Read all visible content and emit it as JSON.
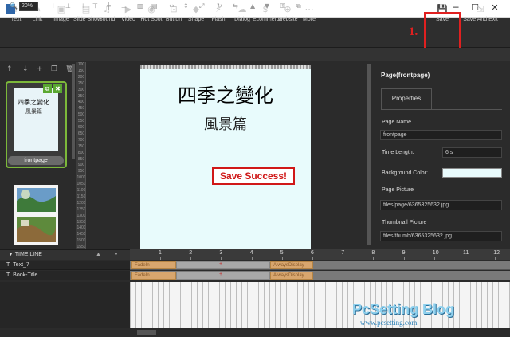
{
  "window": {
    "minimize": "─",
    "maximize": "☐",
    "close": "✕"
  },
  "toolbar": {
    "tools": [
      {
        "icon": "T",
        "label": "Text"
      },
      {
        "icon": "✎",
        "label": "Link"
      },
      {
        "icon": "▣",
        "label": "Image"
      },
      {
        "icon": "▤",
        "label": "Slide Show"
      },
      {
        "icon": "♫",
        "label": "Sound"
      },
      {
        "icon": "▶",
        "label": "Video"
      },
      {
        "icon": "◉",
        "label": "Hot Spot"
      },
      {
        "icon": "⊡",
        "label": "Button"
      },
      {
        "icon": "◆",
        "label": "Shape"
      },
      {
        "icon": "⚡",
        "label": "Flash"
      },
      {
        "icon": "☁",
        "label": "Dialog"
      },
      {
        "icon": "$",
        "label": "Ecommerce"
      },
      {
        "icon": "⊕",
        "label": "Website"
      },
      {
        "icon": "⋯",
        "label": "More"
      }
    ],
    "save": {
      "icon": "💾",
      "label": "Save"
    },
    "save_exit": {
      "icon": "⇲",
      "label": "Save And Exit"
    },
    "step_label": "1."
  },
  "subbar": {
    "zoom": "20%"
  },
  "pages": {
    "thumb1_label": "frontpage",
    "thumb1_title": "四季之變化",
    "thumb1_sub": "風景篇"
  },
  "ruler_numbers": [
    "100",
    "150",
    "200",
    "250",
    "300",
    "350",
    "400",
    "450",
    "500",
    "550",
    "600",
    "650",
    "700",
    "750",
    "800",
    "850",
    "900",
    "950",
    "1000",
    "1050",
    "1100",
    "1150",
    "1200",
    "1250",
    "1300",
    "1350",
    "1400",
    "1450",
    "1500",
    "1550"
  ],
  "canvas": {
    "title": "四季之變化",
    "subtitle": "風景篇",
    "toast": "Save Success!"
  },
  "properties": {
    "header": "Page(frontpage)",
    "tab": "Properties",
    "page_name_label": "Page Name",
    "page_name": "frontpage",
    "time_length_label": "Time Length:",
    "time_length": "6 s",
    "bg_color_label": "Background Color:",
    "bg_color": "#e8fbfc",
    "page_picture_label": "Page Picture",
    "page_picture": "files/page/6365325632.jpg",
    "thumb_picture_label": "Thumbnail Picture",
    "thumb_picture": "files/thumb/6365325632.jpg"
  },
  "timeline": {
    "title": "TIME LINE",
    "ticks": [
      "1",
      "2",
      "3",
      "4",
      "5",
      "6",
      "7",
      "8",
      "9",
      "10",
      "11",
      "12"
    ],
    "tracks": [
      {
        "icon": "T",
        "name": "Text_7",
        "clip_in": "FadeIn",
        "clip_out": "AlwaysDisplay"
      },
      {
        "icon": "T",
        "name": "Book-Title",
        "clip_in": "FadeIn",
        "clip_out": "AlwaysDisplay"
      }
    ]
  },
  "watermark": {
    "brand": "PcSetting Blog",
    "url": "www.pcsetting.com"
  }
}
